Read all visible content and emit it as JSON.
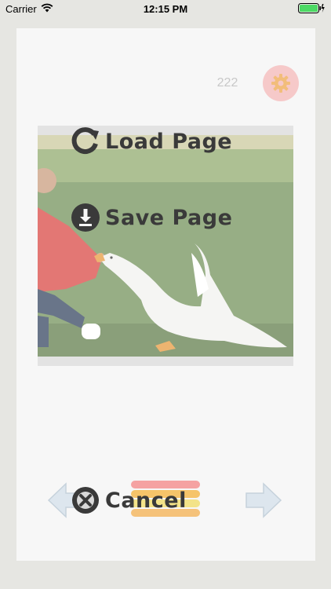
{
  "status_bar": {
    "carrier": "Carrier",
    "time": "12:15 PM",
    "battery_color": "#4cd964"
  },
  "page": {
    "counter": "222"
  },
  "menu": {
    "load_label": "Load Page",
    "save_label": "Save Page",
    "cancel_label": "Cancel"
  },
  "icons": {
    "settings": "gear-icon",
    "load": "reload-icon",
    "save": "download-icon",
    "cancel": "close-icon",
    "prev": "arrow-left-icon",
    "next": "arrow-right-icon",
    "palette": "color-bars-icon"
  },
  "colors": {
    "settings_bg": "#f6c9c9",
    "settings_gear": "#f2bd7a",
    "bar_colors": [
      "#f5a2a2",
      "#f6c46a",
      "#f3e389",
      "#f5c27a"
    ]
  }
}
